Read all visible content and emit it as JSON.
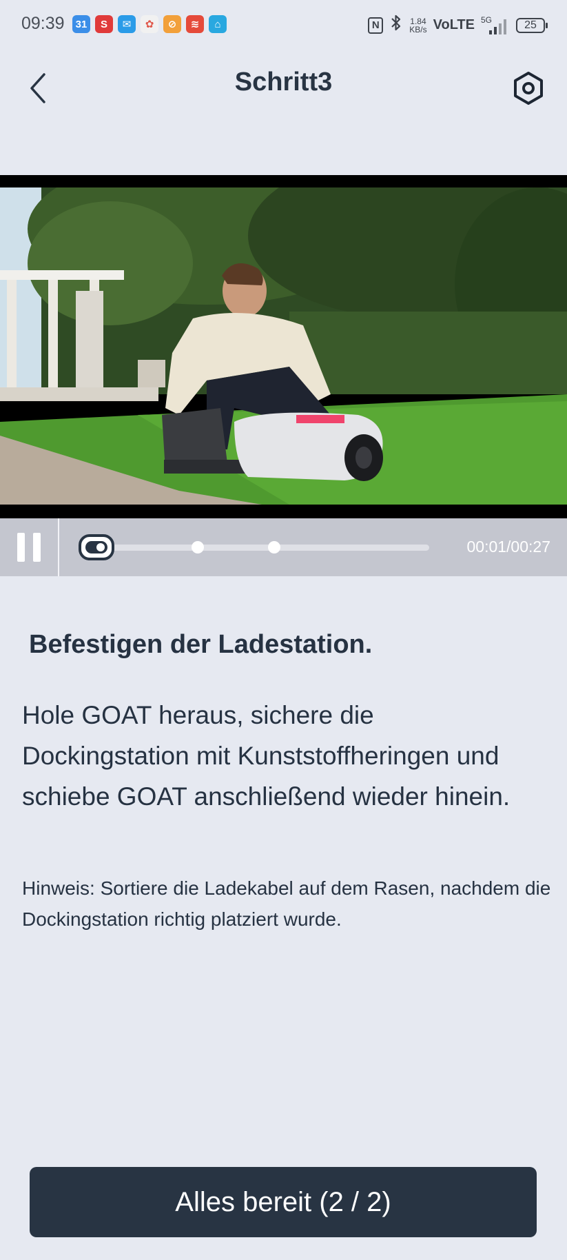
{
  "status_bar": {
    "time": "09:39",
    "notifications": [
      {
        "icon": "calendar-icon",
        "text": "31",
        "color": "#3b8ee8"
      },
      {
        "icon": "s-app-icon",
        "text": "S",
        "color": "#e03a3a"
      },
      {
        "icon": "mail-icon",
        "text": "✉",
        "color": "#2a9be8"
      },
      {
        "icon": "photos-icon",
        "text": "✿",
        "color": "#f1f1f1"
      },
      {
        "icon": "tool-app-icon",
        "text": "⊘",
        "color": "#f2a03a"
      },
      {
        "icon": "red-app-icon",
        "text": "≋",
        "color": "#e54a3a"
      },
      {
        "icon": "home-app-icon",
        "text": "⌂",
        "color": "#29a8e0"
      }
    ],
    "nfc": "N",
    "speed_value": "1.84",
    "speed_unit": "KB/s",
    "volte": "VoLTE",
    "network": "5G",
    "battery": "25"
  },
  "header": {
    "title": "Schritt3"
  },
  "video": {
    "time": "00:01/00:27",
    "progress": 0.037,
    "chapter_markers": [
      0.335,
      0.555
    ]
  },
  "content": {
    "heading": "Befestigen der Ladestation.",
    "body": "Hole GOAT heraus, sichere die Dockingstation mit Kunststoffheringen und schiebe GOAT anschließend wieder hinein.",
    "note": "Hinweis: Sortiere die Ladekabel auf dem Rasen, nachdem die Dockingstation richtig platziert wurde."
  },
  "footer": {
    "button_label": "Alles bereit (2 / 2)"
  },
  "colors": {
    "background": "#e6e9f1",
    "primary": "#283443",
    "controls": "#c4c6cf"
  }
}
